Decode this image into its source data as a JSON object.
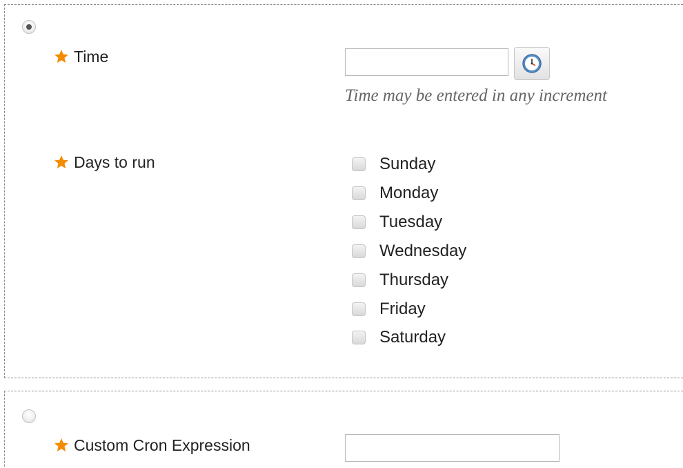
{
  "schedule_option": {
    "selected": true,
    "time": {
      "label": "Time",
      "value": "",
      "placeholder": "",
      "hint": "Time may be entered in any increment"
    },
    "days": {
      "label": "Days to run",
      "options": [
        {
          "label": "Sunday",
          "checked": false
        },
        {
          "label": "Monday",
          "checked": false
        },
        {
          "label": "Tuesday",
          "checked": false
        },
        {
          "label": "Wednesday",
          "checked": false
        },
        {
          "label": "Thursday",
          "checked": false
        },
        {
          "label": "Friday",
          "checked": false
        },
        {
          "label": "Saturday",
          "checked": false
        }
      ]
    }
  },
  "cron_option": {
    "selected": false,
    "label": "Custom Cron Expression",
    "value": ""
  },
  "icons": {
    "required": "required-star-icon",
    "time_picker": "clock-icon"
  },
  "colors": {
    "required_star": "#f28c00",
    "hint_text": "#666666",
    "border_dashed": "#8a8a8a"
  }
}
